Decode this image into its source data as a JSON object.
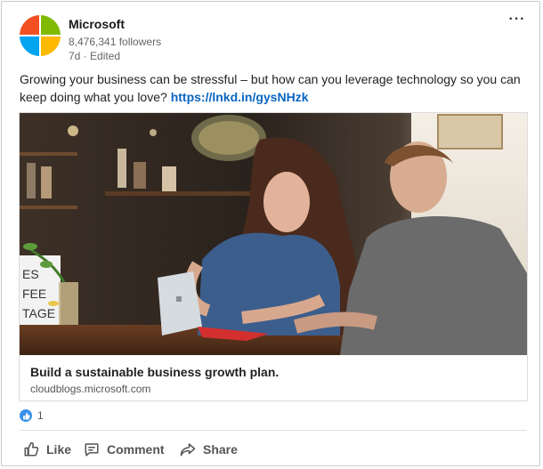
{
  "post": {
    "company": "Microsoft",
    "followers": "8,476,341 followers",
    "meta": "7d · Edited",
    "text": "Growing your business can be stressful – but how can you leverage technology so you can keep doing what you love?",
    "link": "https://lnkd.in/gysNHzk",
    "more_label": "···"
  },
  "article": {
    "title": "Build a sustainable business growth plan.",
    "domain": "cloudblogs.microsoft.com",
    "sign_lines": [
      "ES",
      "FEE",
      "TAGE"
    ]
  },
  "reactions": {
    "count": "1"
  },
  "actions": {
    "like": "Like",
    "comment": "Comment",
    "share": "Share"
  },
  "icons": {
    "logo": "microsoft-logo",
    "like": "thumbs-up-icon",
    "comment": "comment-icon",
    "share": "share-arrow-icon",
    "more": "more-horizontal-icon"
  },
  "colors": {
    "link": "#0a66c2",
    "like_reaction": "#378fe9",
    "ms_red": "#f25022",
    "ms_green": "#7fba00",
    "ms_blue": "#00a4ef",
    "ms_yellow": "#ffb900"
  }
}
